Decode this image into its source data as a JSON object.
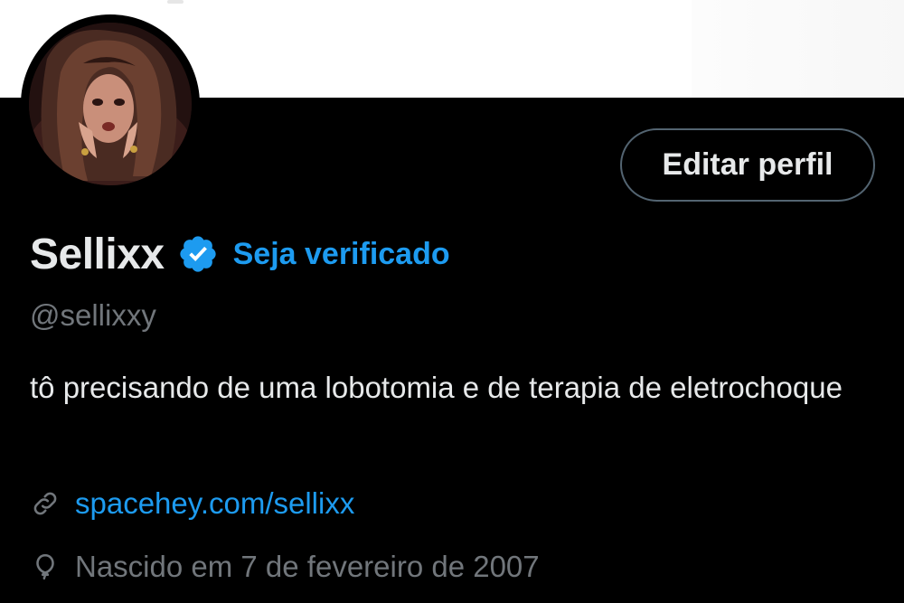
{
  "profile": {
    "name": "Sellixx",
    "verify_label": "Seja verificado",
    "handle": "@sellixxy",
    "bio": "tô precisando de uma lobotomia e de terapia de eletrochoque",
    "website": "spacehey.com/sellixx",
    "birth": "Nascido em 7 de fevereiro de 2007",
    "edit_button": "Editar perfil"
  },
  "icons": {
    "verified": "verified-badge-icon",
    "link": "link-icon",
    "birth": "balloon-icon"
  },
  "colors": {
    "accent": "#1d9bf0",
    "text_primary": "#e7e9ea",
    "text_secondary": "#71767b",
    "border": "#536471",
    "background": "#000000"
  }
}
